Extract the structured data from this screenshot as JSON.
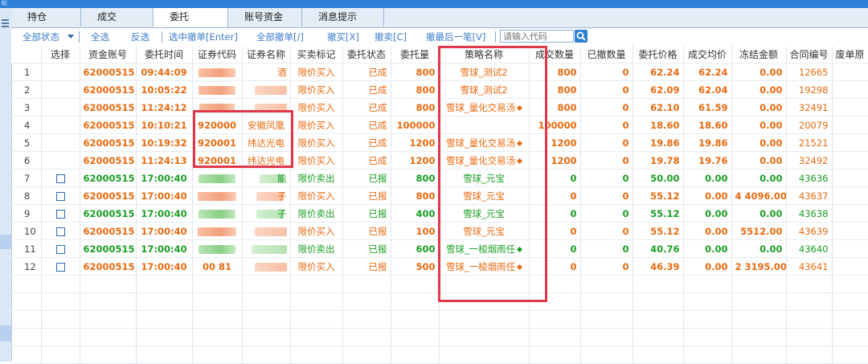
{
  "window": {
    "title": "帖"
  },
  "tabs": [
    {
      "label": "持仓"
    },
    {
      "label": "成交"
    },
    {
      "label": "委托"
    },
    {
      "label": "账号资金"
    },
    {
      "label": "消息提示"
    }
  ],
  "toolbar": {
    "all_status": "全部状态",
    "select_all": "全选",
    "invert": "反选",
    "cancel_selected": "选中撤单[Enter]",
    "cancel_all": "全部撤单[/]",
    "cancel_buy": "撤买[X]",
    "cancel_sell": "撤卖[C]",
    "cancel_last": "撤最后一笔[V]",
    "search_placeholder": "请输入代码"
  },
  "columns": [
    "选择",
    "资金账号",
    "委托时间",
    "证券代码",
    "证券名称",
    "买卖标记",
    "委托状态",
    "委托量",
    "策略名称",
    "成交数量",
    "已撤数量",
    "委托价格",
    "成交均价",
    "冻结金额",
    "合同编号",
    "废单原"
  ],
  "rows": [
    {
      "idx": "1",
      "account": "62000515",
      "time": "09:44:09",
      "code": "",
      "name": "酒",
      "side": "限价买入",
      "status": "已成",
      "qty": "800",
      "strategy": "雪球_测试2",
      "filled": "800",
      "cancelled": "0",
      "price": "62.24",
      "avg": "62.24",
      "frozen": "0.00",
      "contract": "12665"
    },
    {
      "idx": "2",
      "account": "62000515",
      "time": "10:05:22",
      "code": "",
      "name": "",
      "side": "限价买入",
      "status": "已成",
      "qty": "800",
      "strategy": "雪球_测试2",
      "filled": "800",
      "cancelled": "0",
      "price": "62.09",
      "avg": "62.04",
      "frozen": "0.00",
      "contract": "19298"
    },
    {
      "idx": "3",
      "account": "62000515",
      "time": "11:24:12",
      "code": "",
      "name": "",
      "side": "限价买入",
      "status": "已成",
      "qty": "800",
      "strategy": "雪球_量化交易汤",
      "filled": "800",
      "cancelled": "0",
      "price": "62.10",
      "avg": "61.59",
      "frozen": "0.00",
      "contract": "32491"
    },
    {
      "idx": "4",
      "account": "62000515",
      "time": "10:10:21",
      "code": "920000",
      "name": "安徽凤凰",
      "side": "限价买入",
      "status": "已成",
      "qty": "100000",
      "strategy": "",
      "filled": "100000",
      "cancelled": "0",
      "price": "18.60",
      "avg": "18.60",
      "frozen": "0.00",
      "contract": "20079"
    },
    {
      "idx": "5",
      "account": "62000515",
      "time": "10:19:32",
      "code": "920001",
      "name": "纬达光电",
      "side": "限价买入",
      "status": "已成",
      "qty": "1200",
      "strategy": "雪球_量化交易汤",
      "filled": "1200",
      "cancelled": "0",
      "price": "19.86",
      "avg": "19.86",
      "frozen": "0.00",
      "contract": "21521"
    },
    {
      "idx": "6",
      "account": "62000515",
      "time": "11:24:13",
      "code": "920001",
      "name": "纬达光电",
      "side": "限价买入",
      "status": "已成",
      "qty": "1200",
      "strategy": "雪球_量化交易汤",
      "filled": "1200",
      "cancelled": "0",
      "price": "19.78",
      "avg": "19.76",
      "frozen": "0.00",
      "contract": "32492"
    },
    {
      "idx": "7",
      "account": "62000515",
      "time": "17:00:40",
      "code": "",
      "name": "能",
      "side": "限价卖出",
      "status": "已报",
      "qty": "800",
      "strategy": "雪球_元宝",
      "filled": "0",
      "cancelled": "0",
      "price": "50.00",
      "avg": "0.00",
      "frozen": "0.00",
      "contract": "43636"
    },
    {
      "idx": "8",
      "account": "62000515",
      "time": "17:00:40",
      "code": "",
      "name": "子",
      "side": "限价买入",
      "status": "已报",
      "qty": "800",
      "strategy": "雪球_元宝",
      "filled": "0",
      "cancelled": "0",
      "price": "55.12",
      "avg": "0.00",
      "frozen": "4 4096.00",
      "contract": "43637"
    },
    {
      "idx": "9",
      "account": "62000515",
      "time": "17:00:40",
      "code": "",
      "name": "子",
      "side": "限价卖出",
      "status": "已报",
      "qty": "400",
      "strategy": "雪球_元宝",
      "filled": "0",
      "cancelled": "0",
      "price": "55.12",
      "avg": "0.00",
      "frozen": "0.00",
      "contract": "43638"
    },
    {
      "idx": "10",
      "account": "62000515",
      "time": "17:00:40",
      "code": "",
      "name": "",
      "side": "限价买入",
      "status": "已报",
      "qty": "100",
      "strategy": "雪球_元宝",
      "filled": "0",
      "cancelled": "0",
      "price": "55.12",
      "avg": "0.00",
      "frozen": "5512.00",
      "contract": "43639"
    },
    {
      "idx": "11",
      "account": "62000515",
      "time": "17:00:40",
      "code": "",
      "name": "",
      "side": "限价卖出",
      "status": "已报",
      "qty": "600",
      "strategy": "雪球_一梭烟雨任",
      "filled": "0",
      "cancelled": "0",
      "price": "40.76",
      "avg": "0.00",
      "frozen": "0.00",
      "contract": "43640"
    },
    {
      "idx": "12",
      "account": "62000515",
      "time": "17:00:40",
      "code": "00   81",
      "name": "",
      "side": "限价买入",
      "status": "已报",
      "qty": "500",
      "strategy": "雪球_一梭烟雨任",
      "filled": "0",
      "cancelled": "0",
      "price": "46.39",
      "avg": "0.00",
      "frozen": "2 3195.00",
      "contract": "43641"
    }
  ],
  "colors": {
    "buy": "#e86a10",
    "sell": "#1a9e23",
    "highlight": "#e0384a",
    "accent": "#2e7fd6"
  }
}
